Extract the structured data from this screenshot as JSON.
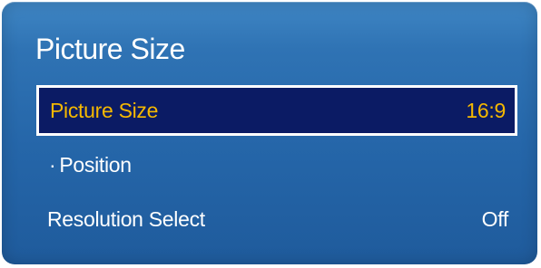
{
  "menu": {
    "title": "Picture Size",
    "items": [
      {
        "label": "Picture Size",
        "value": "16:9",
        "selected": true
      },
      {
        "bullet": "·",
        "label": "Position",
        "value": ""
      },
      {
        "label": "Resolution Select",
        "value": "Off"
      }
    ]
  },
  "colors": {
    "panel_background": "#2566a9",
    "selected_background": "#0b1b64",
    "selected_text": "#f5b800",
    "normal_text": "#ffffff"
  }
}
